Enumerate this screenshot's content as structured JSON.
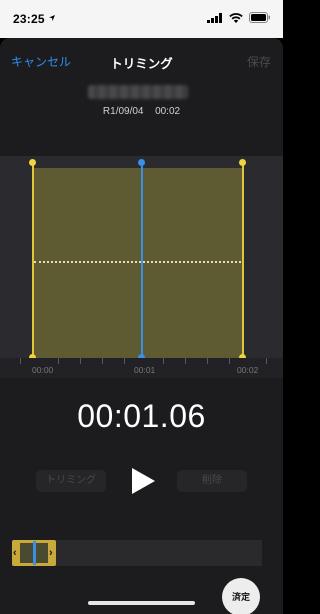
{
  "status_bar": {
    "time": "23:25",
    "location_icon": "location-arrow-icon",
    "signal_icon": "cellular-signal-icon",
    "wifi_icon": "wifi-icon",
    "battery_icon": "battery-icon"
  },
  "nav": {
    "cancel_label": "キャンセル",
    "title": "トリミング",
    "save_label": "保存"
  },
  "recording": {
    "date": "R1/09/04",
    "duration": "00:02"
  },
  "timeline": {
    "labels": [
      "00:00",
      "00:01",
      "00:02"
    ]
  },
  "playback": {
    "elapsed": "00:01.06"
  },
  "buttons": {
    "trim_label": "トリミング",
    "delete_label": "削除",
    "play_icon": "play-icon"
  },
  "overview": {
    "left_chevron": "‹",
    "right_chevron": "›"
  },
  "watermark": {
    "text": "済定"
  },
  "colors": {
    "accent_blue": "#2f8ef0",
    "trim_yellow": "#e2c53a",
    "playhead_blue": "#3b8fe6",
    "sheet_bg": "#1c1c1e"
  }
}
